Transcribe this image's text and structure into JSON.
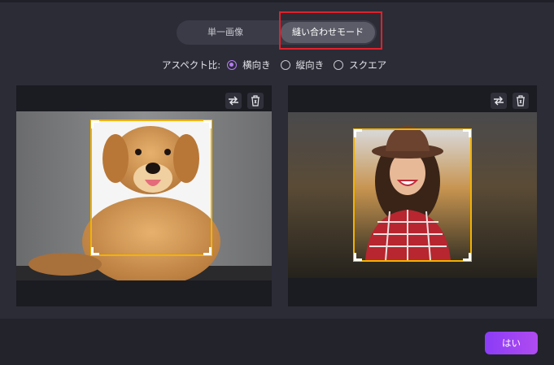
{
  "mode_toggle": {
    "single_label": "単一画像",
    "stitch_label": "縫い合わせモード"
  },
  "aspect": {
    "label": "アスペクト比:",
    "options": [
      {
        "label": "横向き",
        "selected": true
      },
      {
        "label": "縦向き",
        "selected": false
      },
      {
        "label": "スクエア",
        "selected": false
      }
    ]
  },
  "panels": [
    {
      "image": "golden retriever puppy photo",
      "tools": [
        "swap-icon",
        "delete-icon"
      ]
    },
    {
      "image": "smiling woman in hat photo",
      "tools": [
        "swap-icon",
        "delete-icon"
      ]
    }
  ],
  "footer": {
    "confirm_label": "はい"
  },
  "colors": {
    "background": "#2b2c36",
    "accent_purple": "#b57cf2",
    "crop_border": "#f2b200",
    "highlight_red": "#e0212b"
  }
}
